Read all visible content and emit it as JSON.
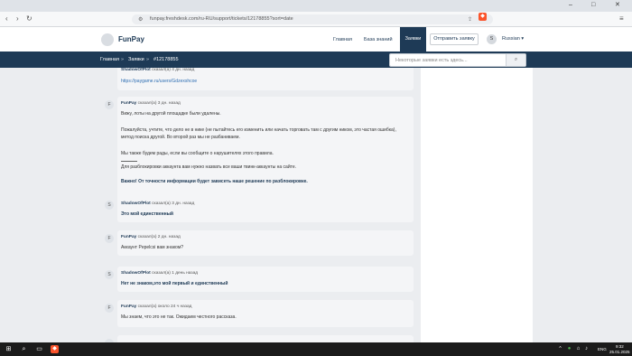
{
  "browser": {
    "url": "funpay.freshdesk.com/ru-RU/support/tickets/12178855?sort=date",
    "window_controls": [
      "–",
      "□",
      "✕"
    ]
  },
  "header": {
    "logo": "FunPay",
    "nav": [
      "Главная",
      "База знаний",
      "Заявки"
    ],
    "submit_button": "Отправить заявку",
    "avatar_letter": "S",
    "language": "Russian ▾"
  },
  "breadcrumb": {
    "items": [
      "Главная",
      "Заявки",
      "#12178855"
    ],
    "search_placeholder": "Некоторые заявки есть здесь..."
  },
  "messages": [
    {
      "avatar": "",
      "author": "ShadowOfPlot",
      "meta": "сказал(а) 4 дн. назад",
      "lines": [
        "https://paygame.ru/users/Gdzexshcoe"
      ]
    },
    {
      "avatar": "F",
      "author": "FunPay",
      "meta": "сказал(а) 3 дн. назад",
      "lines": [
        "Вижу, лоты на другой площадке были удалены.",
        "Пожалуйста, учтите, что дело не в нике (не пытайтесь его изменить или начать торговать там с другим ником, это частая ошибка),",
        "метод поиска другой. Во второй раз мы не разбаниваем.",
        "Мы также будем рады, если вы сообщите о нарушителях этого правила.",
        "Для разблокировки аккаунта вам нужно назвать все ваши твинк-аккаунты на сайте.",
        "Важно! От точности информации будет зависеть наше решение по разблокировке."
      ]
    },
    {
      "avatar": "S",
      "author": "ShadowOfPlot",
      "meta": "сказал(а) 3 дн. назад",
      "lines": [
        "Это мой единственный"
      ]
    },
    {
      "avatar": "F",
      "author": "FunPay",
      "meta": "сказал(а) 2 дн. назад",
      "lines": [
        "Аккаунт Pepelcsi вам знаком?"
      ]
    },
    {
      "avatar": "S",
      "author": "ShadowOfPlot",
      "meta": "сказал(а) 1 день назад",
      "lines": [
        "Нет не знаком,это мой первый и единственный"
      ]
    },
    {
      "avatar": "F",
      "author": "FunPay",
      "meta": "сказал(а) около 24 ч назад",
      "lines": [
        "Мы знаем, что это не так. Ожидаем честного рассказа."
      ]
    }
  ],
  "taskbar": {
    "lang": "ENG",
    "time": "9:32",
    "date": "25.01.2025"
  }
}
